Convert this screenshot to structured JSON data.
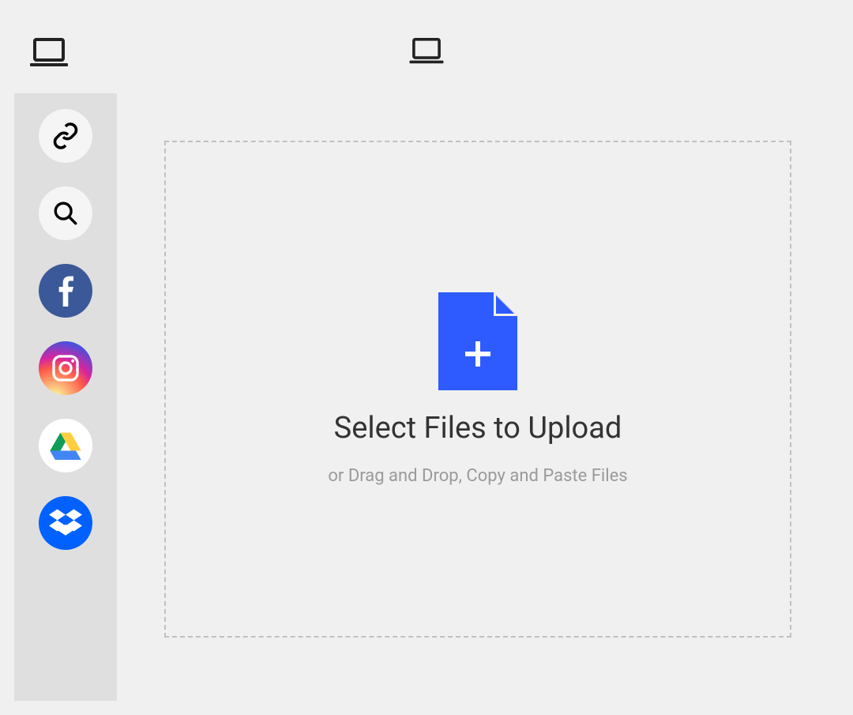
{
  "header": {
    "left_icon": "laptop-icon",
    "center_icon": "laptop-icon"
  },
  "sidebar": {
    "items": [
      {
        "id": "link",
        "icon": "link-icon"
      },
      {
        "id": "search",
        "icon": "search-icon"
      },
      {
        "id": "facebook",
        "icon": "facebook-icon"
      },
      {
        "id": "instagram",
        "icon": "instagram-icon"
      },
      {
        "id": "googledrive",
        "icon": "google-drive-icon"
      },
      {
        "id": "dropbox",
        "icon": "dropbox-icon"
      }
    ]
  },
  "dropzone": {
    "icon": "file-plus-icon",
    "title": "Select Files to Upload",
    "subtitle": "or Drag and Drop, Copy and Paste Files"
  },
  "colors": {
    "accent": "#2d5bff",
    "facebook": "#3b5998",
    "dropbox": "#0061ff",
    "bg": "#f0f0f0",
    "sidebar_bg": "#dfdfdf",
    "text_primary": "#333333",
    "text_secondary": "#9a9a9a"
  }
}
